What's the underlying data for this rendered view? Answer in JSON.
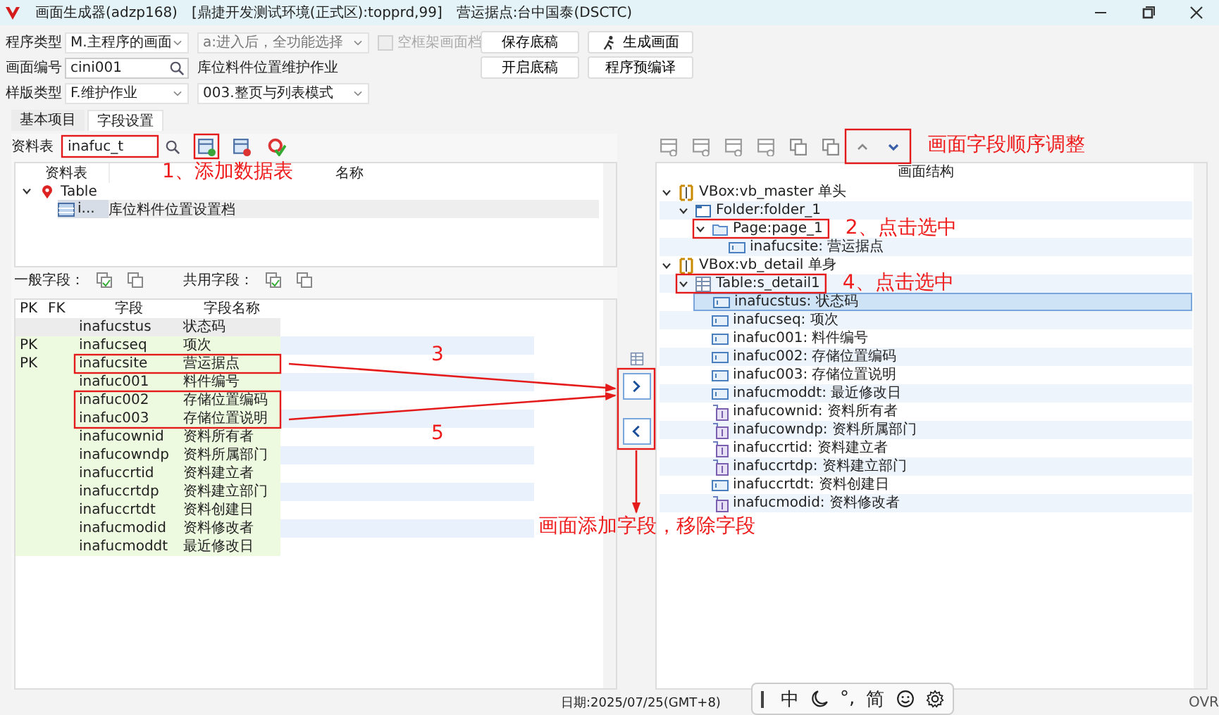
{
  "window": {
    "title": "画面生成器(adzp168)",
    "environment": "[鼎捷开发测试环境(正式区):topprd,99]",
    "site": "营运据点:台中国泰(DSCTC)"
  },
  "form": {
    "program_type": {
      "label": "程序类型",
      "value": "M.主程序的画面"
    },
    "entry_mode": {
      "value": "a:进入后，全功能选择",
      "disabled": true
    },
    "empty_frame": {
      "label": "空框架画面档",
      "checked": false,
      "disabled": true
    },
    "screen_id": {
      "label": "画面编号",
      "value": "cini001"
    },
    "screen_name": "库位料件位置维护作业",
    "template_type": {
      "label": "样版类型",
      "value": "F.维护作业"
    },
    "template_mode": {
      "value": "003.整页与列表模式"
    },
    "buttons": [
      {
        "label": "保存底稿",
        "kind": "plain"
      },
      {
        "label": "生成画面",
        "kind": "run"
      },
      {
        "label": "开启底稿",
        "kind": "plain"
      },
      {
        "label": "程序预编译",
        "kind": "plain"
      }
    ]
  },
  "tabs": [
    {
      "label": "基本项目",
      "selected": false
    },
    {
      "label": "字段设置",
      "selected": true
    }
  ],
  "left_panel": {
    "table_label": "资料表",
    "table_value": "inafuc_t",
    "tree": {
      "columns": [
        "资料表",
        "名称"
      ],
      "nodes": [
        {
          "label": "Table",
          "expanded": true,
          "selected": false,
          "children": [
            {
              "label": "i...",
              "name": "库位料件位置设置档",
              "selected": true
            }
          ]
        }
      ]
    },
    "field_groups": [
      "一般字段：",
      "共用字段："
    ],
    "grid": {
      "columns": [
        "PK",
        "FK",
        "字段",
        "字段名称"
      ],
      "rows": [
        {
          "pk": "",
          "field": "inafucstus",
          "name": "状态码",
          "selected": true
        },
        {
          "pk": "PK",
          "field": "inafucseq",
          "name": "项次",
          "selected": false
        },
        {
          "pk": "PK",
          "field": "inafucsite",
          "name": "营运据点",
          "selected": false
        },
        {
          "pk": "",
          "field": "inafuc001",
          "name": "料件编号",
          "selected": false
        },
        {
          "pk": "",
          "field": "inafuc002",
          "name": "存储位置编码",
          "selected": false
        },
        {
          "pk": "",
          "field": "inafuc003",
          "name": "存储位置说明",
          "selected": false
        },
        {
          "pk": "",
          "field": "inafucownid",
          "name": "资料所有者",
          "selected": false
        },
        {
          "pk": "",
          "field": "inafucowndp",
          "name": "资料所属部门",
          "selected": false
        },
        {
          "pk": "",
          "field": "inafuccrtid",
          "name": "资料建立者",
          "selected": false
        },
        {
          "pk": "",
          "field": "inafuccrtdp",
          "name": "资料建立部门",
          "selected": false
        },
        {
          "pk": "",
          "field": "inafuccrtdt",
          "name": "资料创建日",
          "selected": false
        },
        {
          "pk": "",
          "field": "inafucmodid",
          "name": "资料修改者",
          "selected": false
        },
        {
          "pk": "",
          "field": "inafucmoddt",
          "name": "最近修改日",
          "selected": false
        }
      ]
    }
  },
  "right_panel": {
    "title": "画面结构",
    "nodes": [
      {
        "kind": "vbox",
        "label": "VBox:vb_master 单头",
        "expanded": true,
        "selected": false,
        "children": [
          {
            "kind": "folder",
            "label": "Folder:folder_1",
            "expanded": true,
            "selected": false,
            "children": [
              {
                "kind": "page",
                "label": "Page:page_1",
                "expanded": true,
                "selected": false,
                "children": [
                  {
                    "kind": "field",
                    "label": "inafucsite: 营运据点",
                    "selected": false
                  }
                ]
              }
            ]
          }
        ]
      },
      {
        "kind": "vbox",
        "label": "VBox:vb_detail 单身",
        "expanded": true,
        "selected": false,
        "children": [
          {
            "kind": "table",
            "label": "Table:s_detail1",
            "expanded": true,
            "selected": false,
            "children": [
              {
                "kind": "field",
                "label": "inafucstus: 状态码",
                "selected": true
              },
              {
                "kind": "field",
                "label": "inafucseq: 项次",
                "selected": false
              },
              {
                "kind": "field",
                "label": "inafuc001: 料件编号",
                "selected": false
              },
              {
                "kind": "field",
                "label": "inafuc002: 存储位置编码",
                "selected": false
              },
              {
                "kind": "field",
                "label": "inafuc003: 存储位置说明",
                "selected": false
              },
              {
                "kind": "field",
                "label": "inafucmoddt: 最近修改日",
                "selected": false
              },
              {
                "kind": "ref",
                "label": "inafucownid: 资料所有者",
                "selected": false
              },
              {
                "kind": "ref",
                "label": "inafucowndp: 资料所属部门",
                "selected": false
              },
              {
                "kind": "ref",
                "label": "inafuccrtid: 资料建立者",
                "selected": false
              },
              {
                "kind": "ref",
                "label": "inafuccrtdp: 资料建立部门",
                "selected": false
              },
              {
                "kind": "field",
                "label": "inafuccrtdt: 资料创建日",
                "selected": false
              },
              {
                "kind": "ref",
                "label": "inafucmodid: 资料修改者",
                "selected": false
              }
            ]
          }
        ]
      }
    ]
  },
  "status_bar": {
    "date": "日期:2025/07/25(GMT+8)",
    "mode": "OVR"
  },
  "ime_toolbar": {
    "mode": "中",
    "punctuation": "°,",
    "script": "简"
  },
  "annotations": {
    "add_table": "1、添加数据表",
    "select_page": "2、点击选中",
    "step_3": "3",
    "select_table": "4、点击选中",
    "step_5": "5",
    "reorder": "画面字段顺序调整",
    "add_remove": "画面添加字段，移除字段"
  }
}
